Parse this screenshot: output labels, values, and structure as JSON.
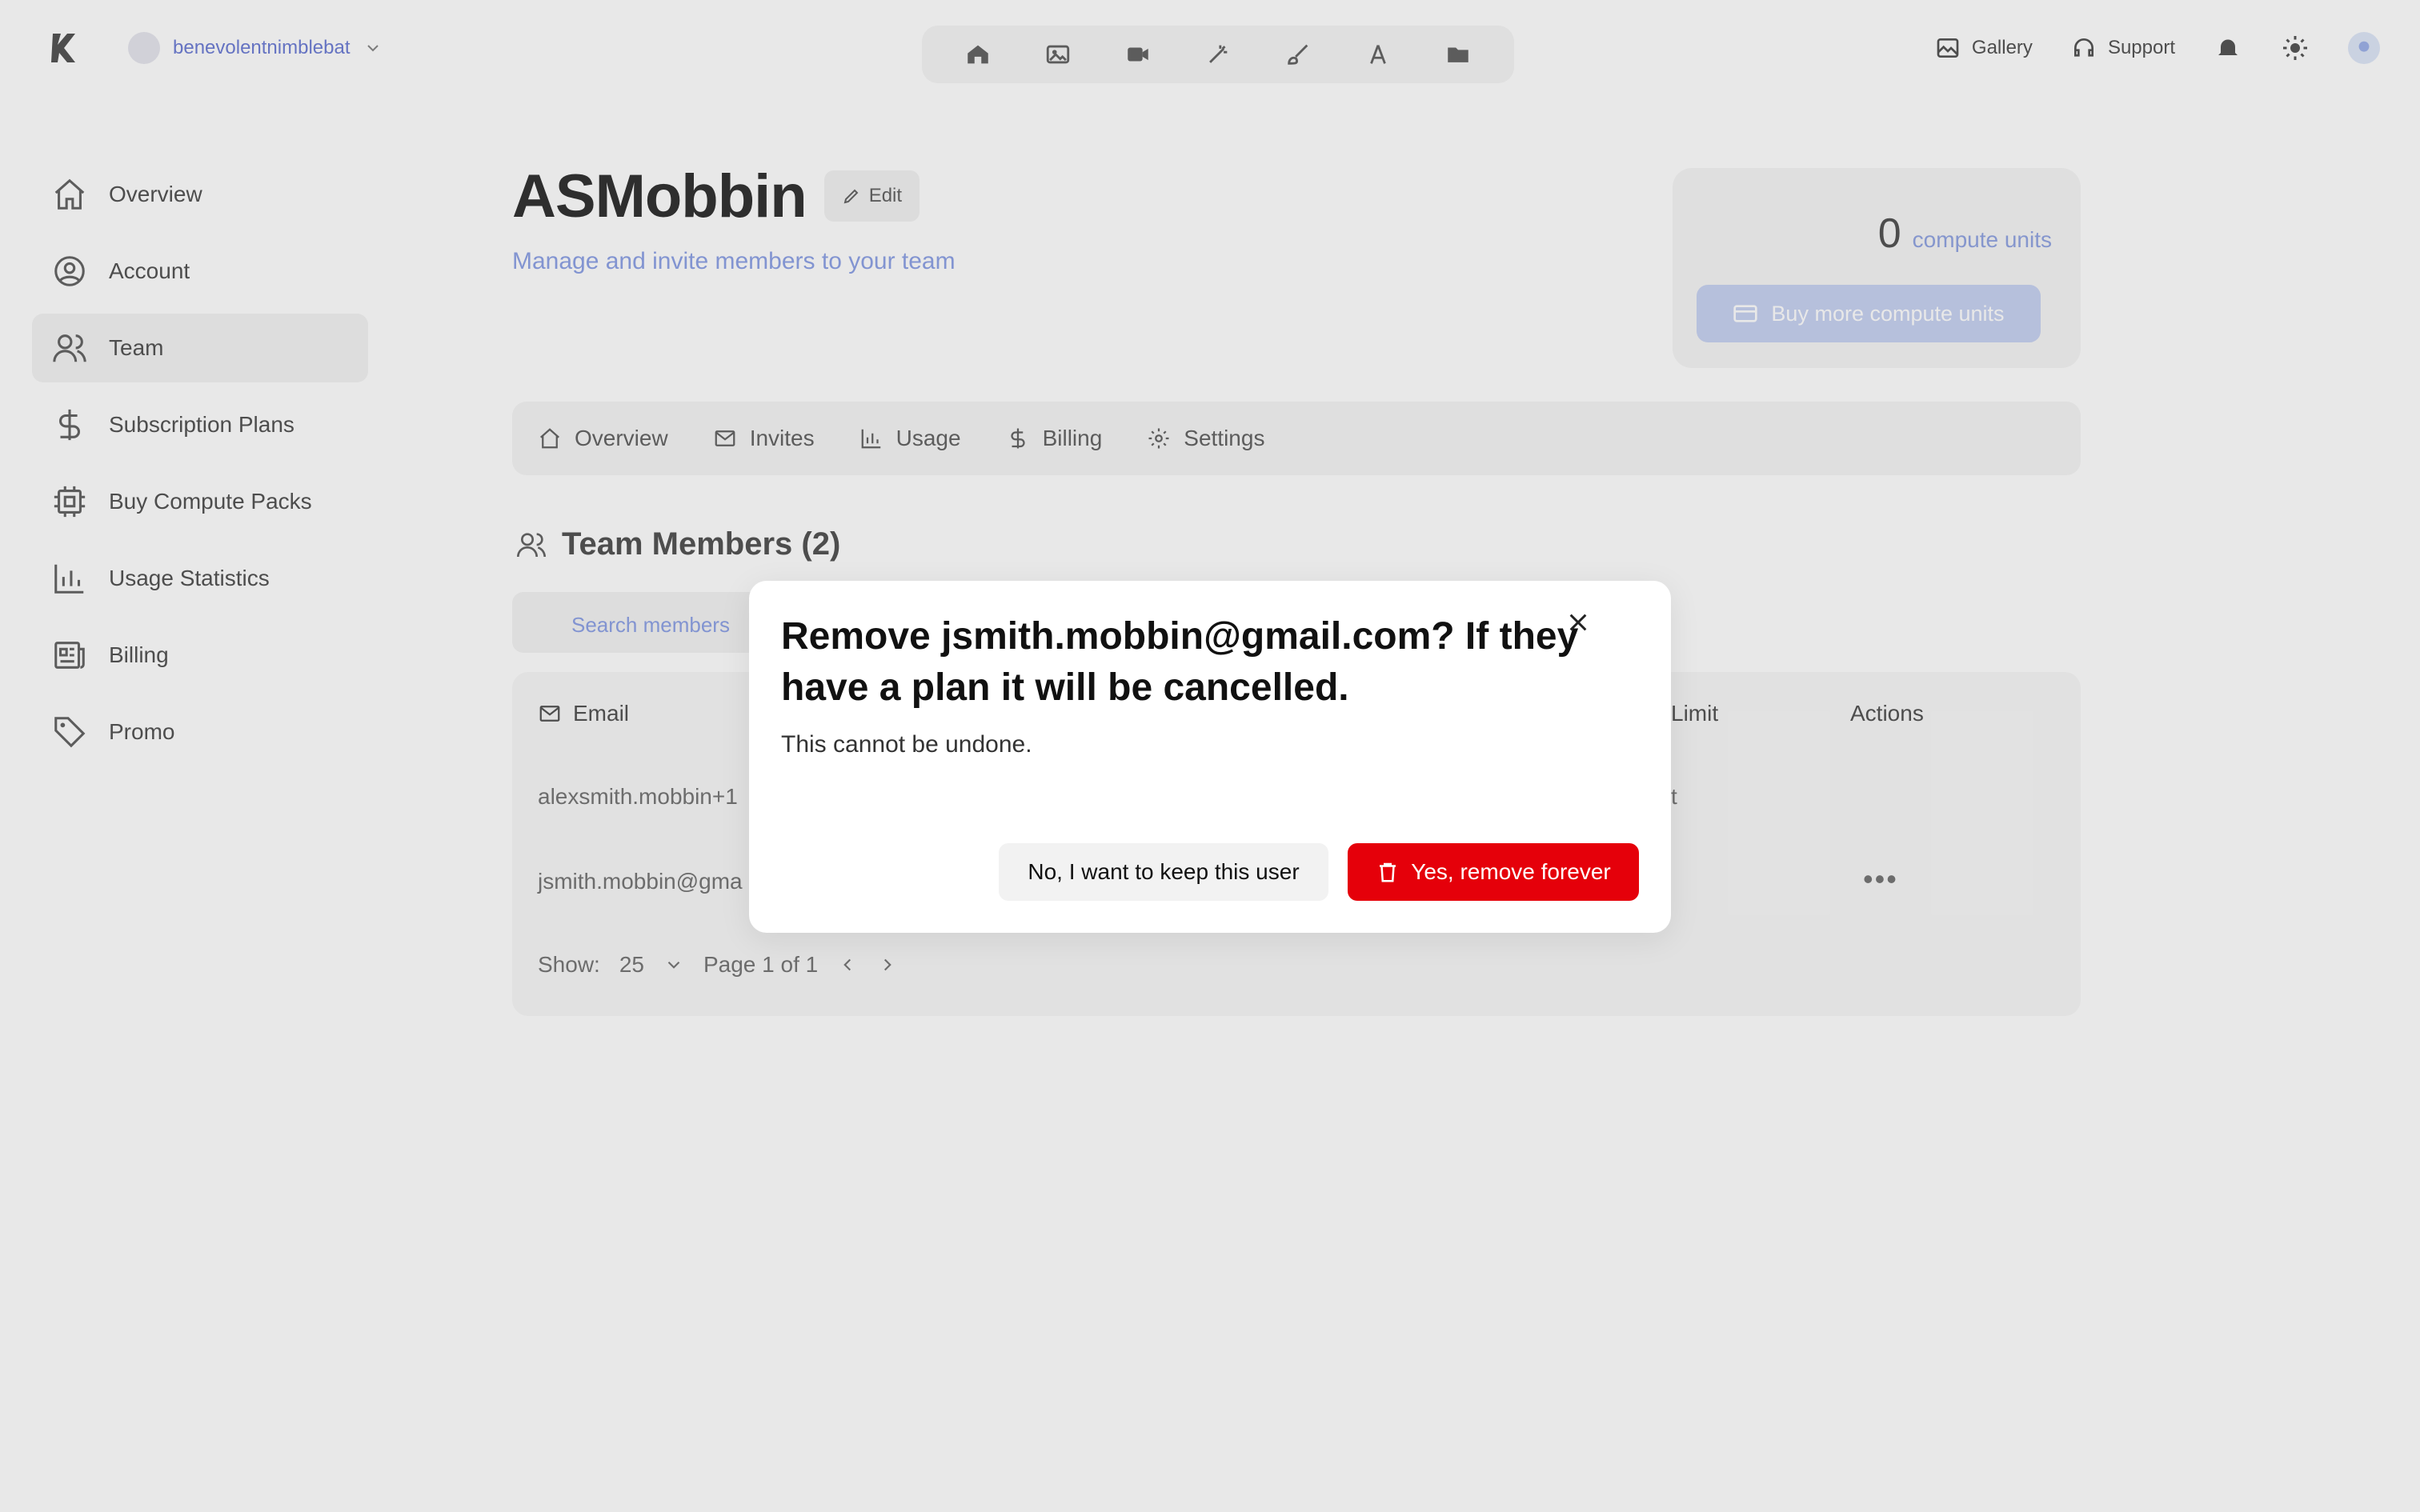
{
  "topbar": {
    "workspace_name": "benevolentnimblebat",
    "gallery_label": "Gallery",
    "support_label": "Support",
    "tool_icons": [
      "home-icon",
      "image-icon",
      "video-icon",
      "magic-wand-icon",
      "brush-icon",
      "text-icon",
      "folder-icon"
    ]
  },
  "sidebar": {
    "items": [
      {
        "label": "Overview",
        "icon": "home-icon"
      },
      {
        "label": "Account",
        "icon": "user-circle-icon"
      },
      {
        "label": "Team",
        "icon": "users-icon",
        "active": true
      },
      {
        "label": "Subscription Plans",
        "icon": "dollar-icon"
      },
      {
        "label": "Buy Compute Packs",
        "icon": "cpu-icon"
      },
      {
        "label": "Usage Statistics",
        "icon": "bar-chart-icon"
      },
      {
        "label": "Billing",
        "icon": "receipt-icon"
      },
      {
        "label": "Promo",
        "icon": "tag-icon"
      }
    ]
  },
  "header": {
    "title": "ASMobbin",
    "edit_label": "Edit",
    "subtitle": "Manage and invite members to your team"
  },
  "compute": {
    "amount": "0",
    "unit": "compute units",
    "buy_label": "Buy more compute units"
  },
  "tabs": [
    "Overview",
    "Invites",
    "Usage",
    "Billing",
    "Settings"
  ],
  "members": {
    "title": "Team Members (2)",
    "search_placeholder": "Search members",
    "columns": {
      "email": "Email",
      "limit": "Limit",
      "actions": "Actions"
    },
    "rows": [
      "alexsmith.mobbin+1",
      "jsmith.mobbin@gma"
    ],
    "row_limit_fragment": "t"
  },
  "pagination": {
    "show_label": "Show:",
    "page_size": "25",
    "page_text": "Page 1 of 1"
  },
  "dialog": {
    "title": "Remove jsmith.mobbin@gmail.com? If they have a plan it will be cancelled.",
    "description": "This cannot be undone.",
    "cancel_label": "No, I want to keep this user",
    "confirm_label": "Yes, remove forever"
  },
  "colors": {
    "danger": "#e5000a",
    "accent_light": "#c9d3f2",
    "accent_text": "#8fa3e6"
  }
}
